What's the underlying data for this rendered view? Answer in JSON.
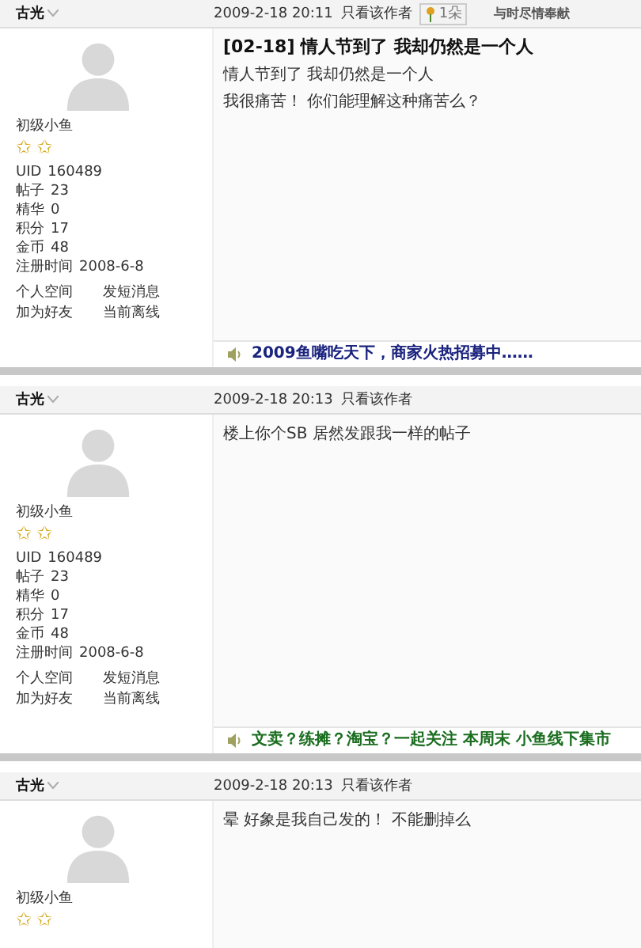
{
  "posts": [
    {
      "author": "古光",
      "time": "2009-2-18 20:11",
      "only_author": "只看该作者",
      "flower": "1朵",
      "slogan": "与时尽情奉献",
      "title": "[02-18] 情人节到了 我却仍然是一个人",
      "body": [
        "情人节到了 我却仍然是一个人",
        "我很痛苦！ 你们能理解这种痛苦么？"
      ],
      "rank": "初级小鱼",
      "rank_icons": [
        "✩",
        "✩"
      ],
      "stats": [
        {
          "label": "UID",
          "value": "160489"
        },
        {
          "label": "帖子",
          "value": "23"
        },
        {
          "label": "精华",
          "value": "0"
        },
        {
          "label": "积分",
          "value": "17"
        },
        {
          "label": "金币",
          "value": "48"
        },
        {
          "label": "注册时间",
          "value": "2008-6-8"
        }
      ],
      "links": [
        "个人空间",
        "发短消息",
        "加为好友",
        "当前离线"
      ],
      "ad": {
        "text": "2009鱼嘴吃天下，商家火热招募中……",
        "color": "#1a237e"
      }
    },
    {
      "author": "古光",
      "time": "2009-2-18 20:13",
      "only_author": "只看该作者",
      "body": [
        "楼上你个SB 居然发跟我一样的帖子"
      ],
      "rank": "初级小鱼",
      "rank_icons": [
        "✩",
        "✩"
      ],
      "stats": [
        {
          "label": "UID",
          "value": "160489"
        },
        {
          "label": "帖子",
          "value": "23"
        },
        {
          "label": "精华",
          "value": "0"
        },
        {
          "label": "积分",
          "value": "17"
        },
        {
          "label": "金币",
          "value": "48"
        },
        {
          "label": "注册时间",
          "value": "2008-6-8"
        }
      ],
      "links": [
        "个人空间",
        "发短消息",
        "加为好友",
        "当前离线"
      ],
      "ad": {
        "text": "文卖？练摊？淘宝？一起关注 本周末 小鱼线下集市",
        "color": "#1b6e20"
      }
    },
    {
      "author": "古光",
      "time": "2009-2-18 20:13",
      "only_author": "只看该作者",
      "body": [
        "晕 好象是我自己发的！ 不能删掉么"
      ],
      "rank": "初级小鱼",
      "rank_icons": [
        "✩",
        "✩"
      ]
    }
  ]
}
